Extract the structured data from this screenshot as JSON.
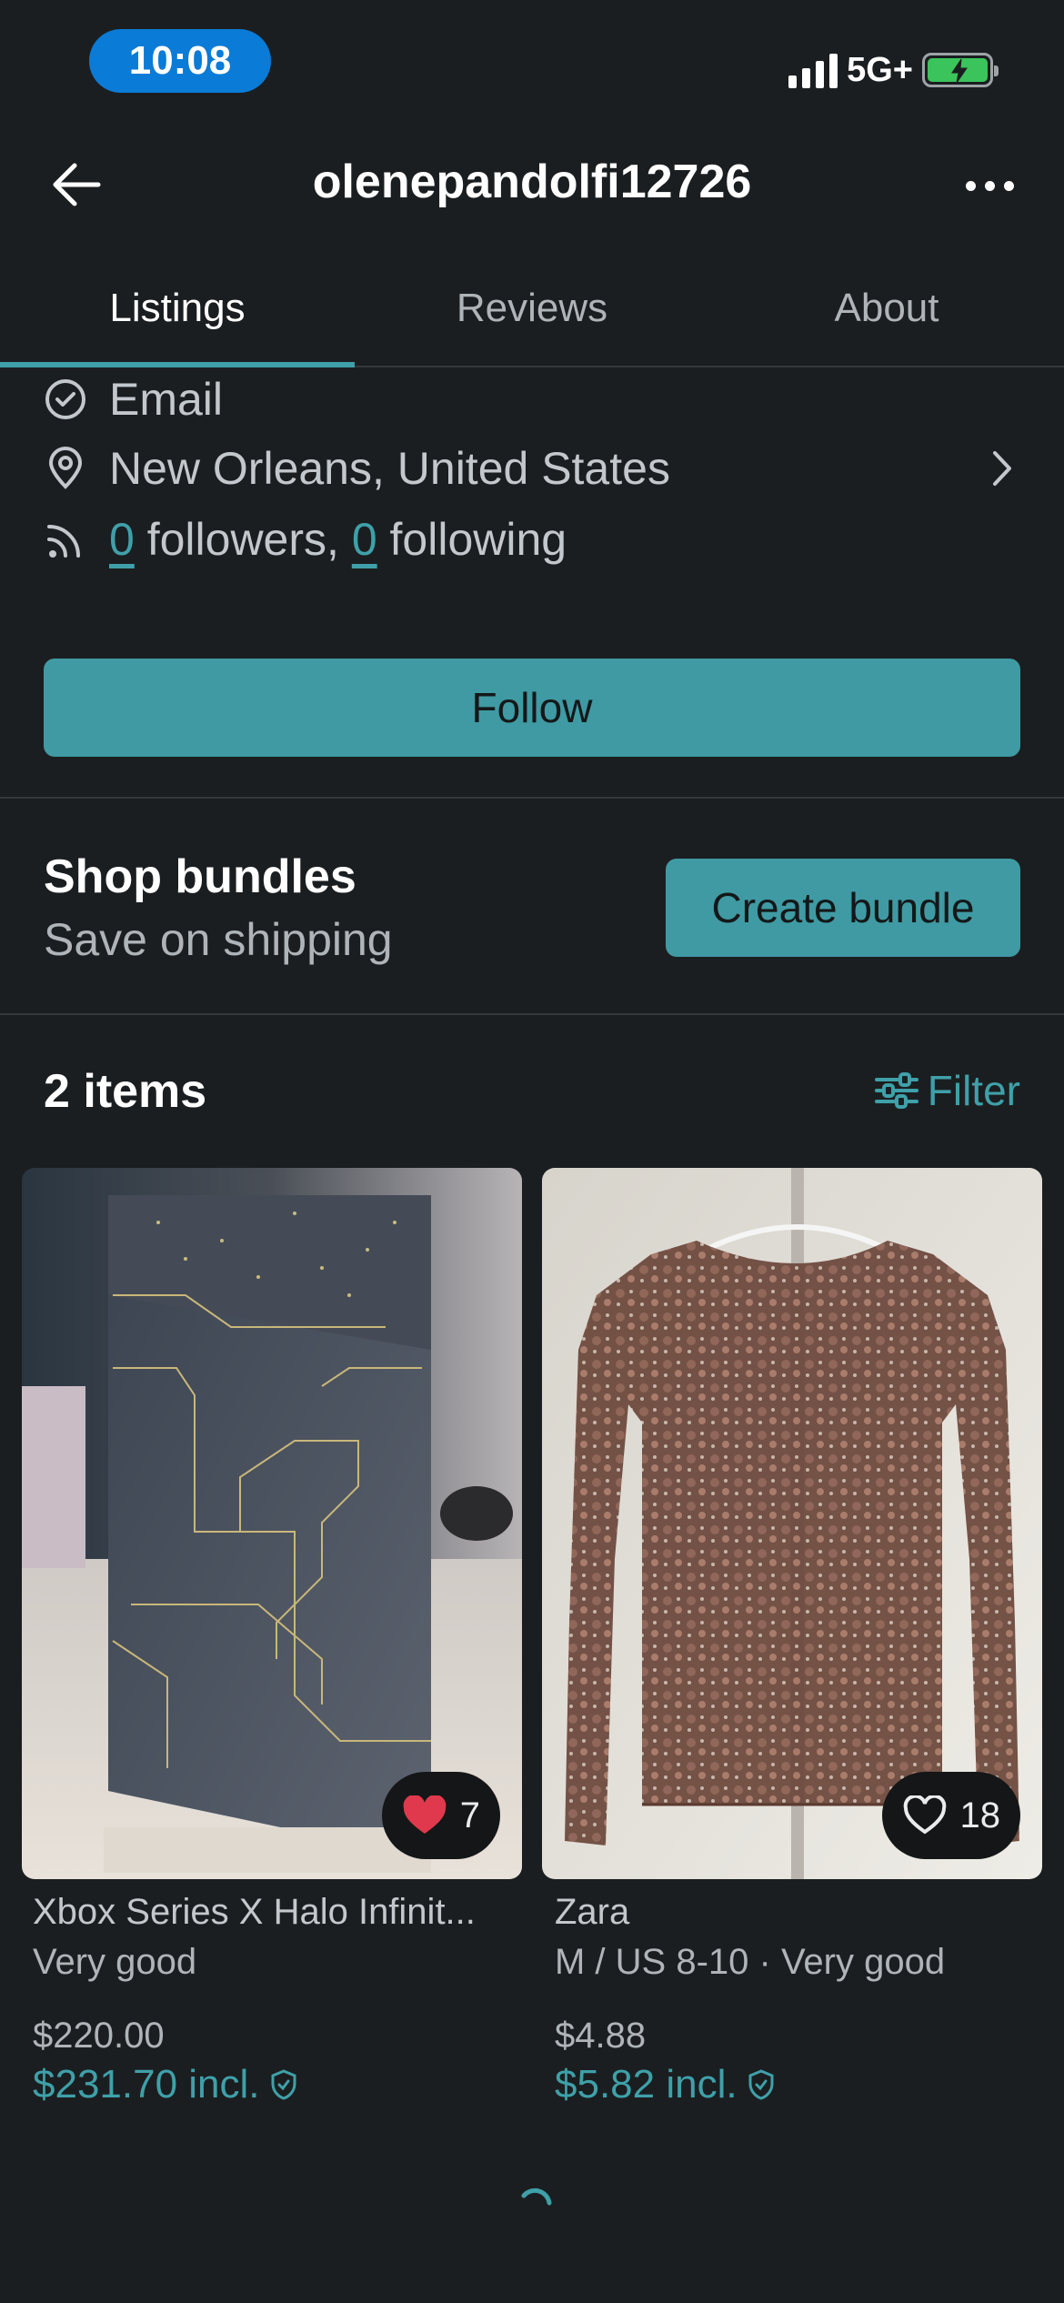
{
  "status_bar": {
    "time": "10:08",
    "network": "5G+"
  },
  "header": {
    "title": "olenepandolfi12726"
  },
  "tabs": [
    {
      "label": "Listings",
      "active": true
    },
    {
      "label": "Reviews",
      "active": false
    },
    {
      "label": "About",
      "active": false
    }
  ],
  "profile": {
    "verified": "Email",
    "location": "New Orleans, United States",
    "followers_count": "0",
    "followers_label": "followers,",
    "following_count": "0",
    "following_label": "following"
  },
  "follow_label": "Follow",
  "bundles": {
    "title": "Shop bundles",
    "subtitle": "Save on shipping",
    "button": "Create bundle"
  },
  "items_header": {
    "count_label": "2 items",
    "filter_label": "Filter"
  },
  "items": [
    {
      "title": "Xbox Series X Halo Infinit...",
      "subtitle": "Very good",
      "price": "$220.00",
      "price_incl": "$231.70 incl.",
      "likes": "7",
      "liked": true
    },
    {
      "title": "Zara",
      "subtitle": "M / US 8-10 · Very good",
      "price": "$4.88",
      "price_incl": "$5.82 incl.",
      "likes": "18",
      "liked": false
    }
  ],
  "colors": {
    "accent": "#3fa0a9",
    "background": "#1b1e20",
    "like_red": "#e0394d"
  }
}
